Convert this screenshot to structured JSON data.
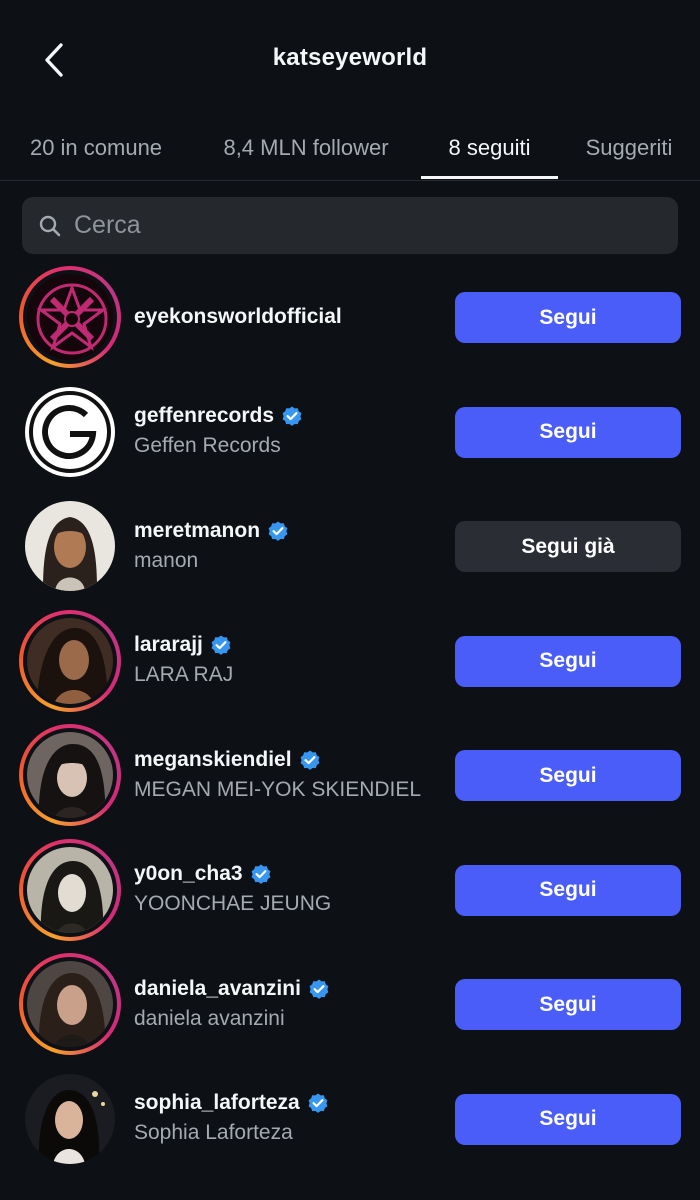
{
  "header": {
    "title": "katseyeworld",
    "back_icon": "chevron-left-icon"
  },
  "tabs": [
    {
      "label": "20 in comune",
      "active": false
    },
    {
      "label": "8,4 MLN follower",
      "active": false
    },
    {
      "label": "8 seguiti",
      "active": true
    },
    {
      "label": "Suggeriti",
      "active": false
    }
  ],
  "search": {
    "placeholder": "Cerca",
    "value": "",
    "icon": "search-icon"
  },
  "colors": {
    "background": "#0d1015",
    "follow_button": "#4a5df9",
    "following_button": "#2a2d33",
    "verified": "#3797f0",
    "secondary_text": "#a5a9b1"
  },
  "accounts": [
    {
      "username": "eyekonsworldofficial",
      "full_name": "",
      "verified": false,
      "story_ring": true,
      "button": "Segui",
      "following": false
    },
    {
      "username": "geffenrecords",
      "full_name": "Geffen Records",
      "verified": true,
      "story_ring": false,
      "button": "Segui",
      "following": false
    },
    {
      "username": "meretmanon",
      "full_name": "manon",
      "verified": true,
      "story_ring": false,
      "button": "Segui già",
      "following": true
    },
    {
      "username": "lararajj",
      "full_name": "LARA RAJ",
      "verified": true,
      "story_ring": true,
      "button": "Segui",
      "following": false
    },
    {
      "username": "meganskiendiel",
      "full_name": "MEGAN MEI-YOK SKIENDIEL",
      "verified": true,
      "story_ring": true,
      "button": "Segui",
      "following": false
    },
    {
      "username": "y0on_cha3",
      "full_name": "YOONCHAE JEUNG",
      "verified": true,
      "story_ring": true,
      "button": "Segui",
      "following": false
    },
    {
      "username": "daniela_avanzini",
      "full_name": "daniela avanzini",
      "verified": true,
      "story_ring": true,
      "button": "Segui",
      "following": false
    },
    {
      "username": "sophia_laforteza",
      "full_name": "Sophia Laforteza",
      "verified": true,
      "story_ring": false,
      "button": "Segui",
      "following": false
    }
  ]
}
